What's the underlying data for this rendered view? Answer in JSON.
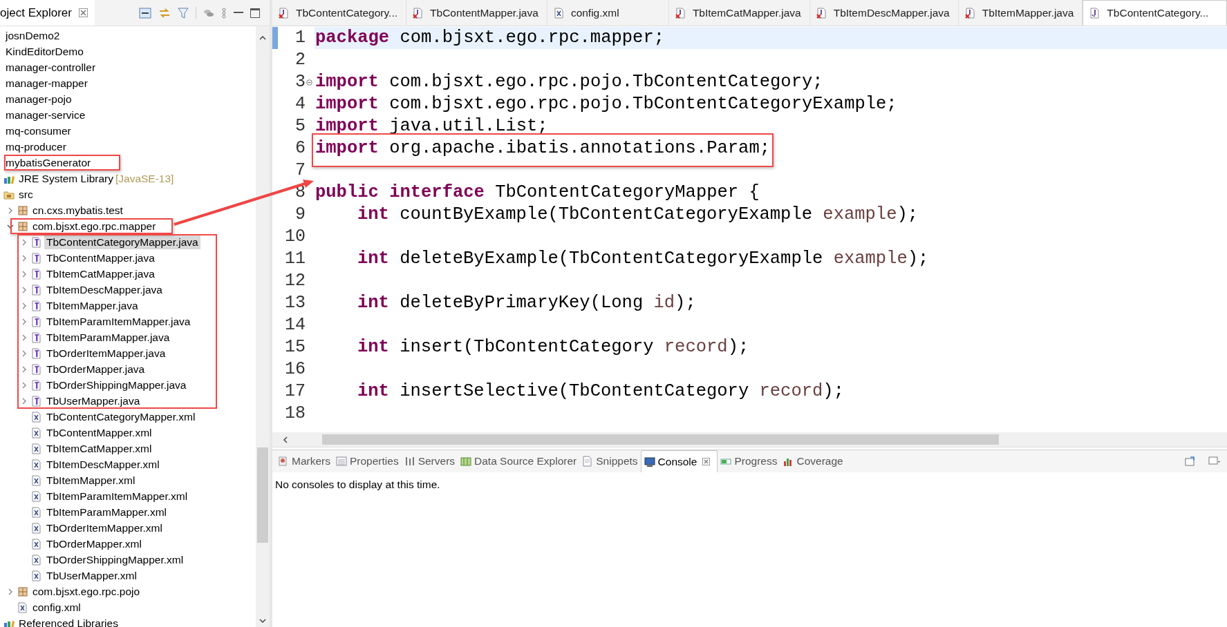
{
  "explorer": {
    "title": "oject Explorer",
    "tree": [
      {
        "label": "josnDemo2",
        "selected": false,
        "highlighted": false
      },
      {
        "label": "KindEditorDemo",
        "selected": false,
        "highlighted": false
      },
      {
        "label": "manager-controller",
        "selected": false,
        "highlighted": false
      },
      {
        "label": "manager-mapper",
        "selected": false,
        "highlighted": false
      },
      {
        "label": "manager-pojo",
        "selected": false,
        "highlighted": false
      },
      {
        "label": "manager-service",
        "selected": false,
        "highlighted": false
      },
      {
        "label": "mq-consumer",
        "selected": false,
        "highlighted": false
      },
      {
        "label": "mq-producer",
        "selected": false,
        "highlighted": false
      },
      {
        "label": "mybatisGenerator",
        "selected": false,
        "highlighted": true,
        "children": [
          {
            "label": "JRE System Library",
            "decoration": "[JavaSE-13]",
            "kind": "library",
            "selected": false,
            "highlighted": false
          },
          {
            "label": "src",
            "kind": "source-folder",
            "selected": false,
            "highlighted": false,
            "children": [
              {
                "label": "cn.cxs.mybatis.test",
                "kind": "package",
                "expanded": false,
                "selected": false,
                "highlighted": false
              },
              {
                "label": "com.bjsxt.ego.rpc.mapper",
                "kind": "package",
                "expanded": true,
                "selected": false,
                "highlighted": true,
                "children": [
                  {
                    "label": "TbContentCategoryMapper.java",
                    "kind": "java",
                    "expanded": false,
                    "selected": true,
                    "highlighted": true
                  },
                  {
                    "label": "TbContentMapper.java",
                    "kind": "java",
                    "expanded": false,
                    "selected": false,
                    "highlighted": true
                  },
                  {
                    "label": "TbItemCatMapper.java",
                    "kind": "java",
                    "expanded": false,
                    "selected": false,
                    "highlighted": true
                  },
                  {
                    "label": "TbItemDescMapper.java",
                    "kind": "java",
                    "expanded": false,
                    "selected": false,
                    "highlighted": true
                  },
                  {
                    "label": "TbItemMapper.java",
                    "kind": "java",
                    "expanded": false,
                    "selected": false,
                    "highlighted": true
                  },
                  {
                    "label": "TbItemParamItemMapper.java",
                    "kind": "java",
                    "expanded": false,
                    "selected": false,
                    "highlighted": true
                  },
                  {
                    "label": "TbItemParamMapper.java",
                    "kind": "java",
                    "expanded": false,
                    "selected": false,
                    "highlighted": true
                  },
                  {
                    "label": "TbOrderItemMapper.java",
                    "kind": "java",
                    "expanded": false,
                    "selected": false,
                    "highlighted": true
                  },
                  {
                    "label": "TbOrderMapper.java",
                    "kind": "java",
                    "expanded": false,
                    "selected": false,
                    "highlighted": true
                  },
                  {
                    "label": "TbOrderShippingMapper.java",
                    "kind": "java",
                    "expanded": false,
                    "selected": false,
                    "highlighted": true
                  },
                  {
                    "label": "TbUserMapper.java",
                    "kind": "java",
                    "expanded": false,
                    "selected": false,
                    "highlighted": true
                  },
                  {
                    "label": "TbContentCategoryMapper.xml",
                    "kind": "xml",
                    "selected": false,
                    "highlighted": false
                  },
                  {
                    "label": "TbContentMapper.xml",
                    "kind": "xml",
                    "selected": false,
                    "highlighted": false
                  },
                  {
                    "label": "TbItemCatMapper.xml",
                    "kind": "xml",
                    "selected": false,
                    "highlighted": false
                  },
                  {
                    "label": "TbItemDescMapper.xml",
                    "kind": "xml",
                    "selected": false,
                    "highlighted": false
                  },
                  {
                    "label": "TbItemMapper.xml",
                    "kind": "xml",
                    "selected": false,
                    "highlighted": false
                  },
                  {
                    "label": "TbItemParamItemMapper.xml",
                    "kind": "xml",
                    "selected": false,
                    "highlighted": false
                  },
                  {
                    "label": "TbItemParamMapper.xml",
                    "kind": "xml",
                    "selected": false,
                    "highlighted": false
                  },
                  {
                    "label": "TbOrderItemMapper.xml",
                    "kind": "xml",
                    "selected": false,
                    "highlighted": false
                  },
                  {
                    "label": "TbOrderMapper.xml",
                    "kind": "xml",
                    "selected": false,
                    "highlighted": false
                  },
                  {
                    "label": "TbOrderShippingMapper.xml",
                    "kind": "xml",
                    "selected": false,
                    "highlighted": false
                  },
                  {
                    "label": "TbUserMapper.xml",
                    "kind": "xml",
                    "selected": false,
                    "highlighted": false
                  }
                ]
              },
              {
                "label": "com.bjsxt.ego.rpc.pojo",
                "kind": "package",
                "expanded": false,
                "selected": false,
                "highlighted": false
              },
              {
                "label": "config.xml",
                "kind": "xml",
                "selected": false,
                "highlighted": false
              }
            ]
          },
          {
            "label": "Referenced Libraries",
            "kind": "library",
            "selected": false,
            "highlighted": false
          }
        ]
      }
    ]
  },
  "editor": {
    "tabs": [
      {
        "label": "TbContentCategory...",
        "kind": "java-error",
        "selected": false
      },
      {
        "label": "TbContentMapper.java",
        "kind": "java-error",
        "selected": false
      },
      {
        "label": "config.xml",
        "kind": "xml",
        "selected": false
      },
      {
        "label": "TbItemCatMapper.java",
        "kind": "java-error",
        "selected": false
      },
      {
        "label": "TbItemDescMapper.java",
        "kind": "java-error",
        "selected": false
      },
      {
        "label": "TbItemMapper.java",
        "kind": "java-error",
        "selected": false
      },
      {
        "label": "TbContentCategory...",
        "kind": "java",
        "selected": true
      }
    ],
    "lines": [
      {
        "number": "1",
        "current": true,
        "highlighted": false,
        "foldable": false,
        "indented": false,
        "text": "**package** com.bjsxt.ego.rpc.mapper;"
      },
      {
        "number": "2",
        "current": false,
        "foldable": false
      },
      {
        "number": "3",
        "current": false,
        "highlighted": false,
        "foldable": true,
        "indented": false,
        "text": "**import** com.bjsxt.ego.rpc.pojo.TbContentCategory;"
      },
      {
        "number": "4",
        "current": false,
        "highlighted": false,
        "foldable": false,
        "indented": false,
        "text": "**import** com.bjsxt.ego.rpc.pojo.TbContentCategoryExample;"
      },
      {
        "number": "5",
        "current": false,
        "highlighted": false,
        "foldable": false,
        "indented": false,
        "text": "**import** java.util.List;"
      },
      {
        "number": "6",
        "current": false,
        "highlighted": true,
        "foldable": false,
        "indented": false,
        "text": "**import** org.apache.ibatis.annotations.Param;"
      },
      {
        "number": "7",
        "current": false,
        "foldable": false
      },
      {
        "number": "8",
        "current": false,
        "highlighted": false,
        "foldable": false,
        "indented": false,
        "text": "**public** **interface** TbContentCategoryMapper {"
      },
      {
        "number": "9",
        "current": false,
        "highlighted": false,
        "foldable": false,
        "indented": true,
        "text": "**int** countByExample(TbContentCategoryExample *example*);"
      },
      {
        "number": "10",
        "current": false,
        "foldable": false
      },
      {
        "number": "11",
        "current": false,
        "highlighted": false,
        "foldable": false,
        "indented": true,
        "text": "**int** deleteByExample(TbContentCategoryExample *example*);"
      },
      {
        "number": "12",
        "current": false,
        "foldable": false
      },
      {
        "number": "13",
        "current": false,
        "highlighted": false,
        "foldable": false,
        "indented": true,
        "text": "**int** deleteByPrimaryKey(Long *id*);"
      },
      {
        "number": "14",
        "current": false,
        "foldable": false
      },
      {
        "number": "15",
        "current": false,
        "highlighted": false,
        "foldable": false,
        "indented": true,
        "text": "**int** insert(TbContentCategory *record*);"
      },
      {
        "number": "16",
        "current": false,
        "foldable": false
      },
      {
        "number": "17",
        "current": false,
        "highlighted": false,
        "foldable": false,
        "indented": true,
        "text": "**int** insertSelective(TbContentCategory *record*);"
      },
      {
        "number": "18",
        "current": false,
        "foldable": false
      }
    ]
  },
  "bottom_panel": {
    "tabs": [
      {
        "label": "Markers",
        "kind": "markers",
        "selected": false
      },
      {
        "label": "Properties",
        "kind": "properties",
        "selected": false
      },
      {
        "label": "Servers",
        "kind": "servers",
        "selected": false
      },
      {
        "label": "Data Source Explorer",
        "kind": "datasource",
        "selected": false
      },
      {
        "label": "Snippets",
        "kind": "snippets",
        "selected": false
      },
      {
        "label": "Console",
        "kind": "console",
        "selected": true
      },
      {
        "label": "Progress",
        "kind": "progress",
        "selected": false
      },
      {
        "label": "Coverage",
        "kind": "coverage",
        "selected": false
      }
    ],
    "message": "No consoles to display at this time."
  }
}
